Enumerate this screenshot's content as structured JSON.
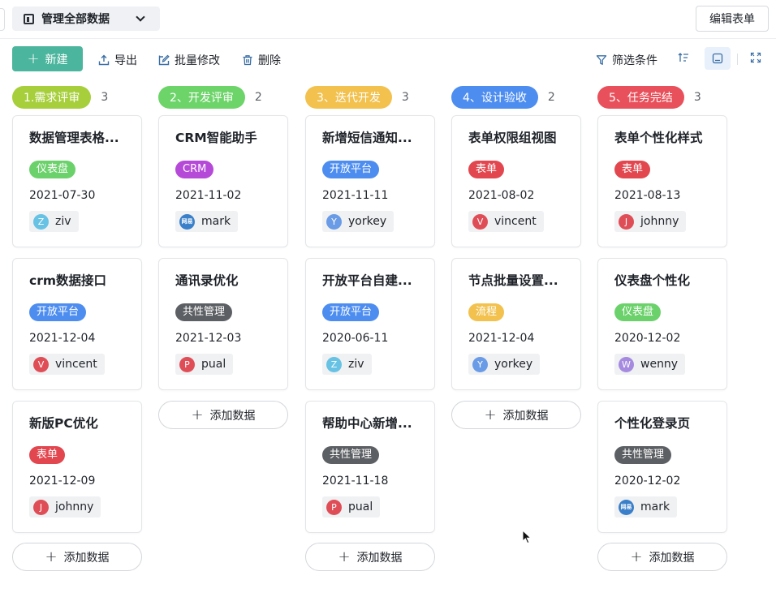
{
  "header": {
    "view_title": "管理全部数据",
    "edit_form_label": "编辑表单"
  },
  "toolbar": {
    "new_label": "新建",
    "export_label": "导出",
    "batch_edit_label": "批量修改",
    "delete_label": "删除",
    "filter_label": "筛选条件"
  },
  "add_data_label": "添加数据",
  "colors": {
    "primary": "#4cb59d",
    "stage1": "#a6cf3b",
    "stage2": "#6dd46a",
    "stage3": "#f2c14e",
    "stage4": "#4d8df0",
    "stage5": "#e8505b",
    "tag_dashboard": "#6bd16b",
    "tag_crm": "#b64ad8",
    "tag_open_platform": "#4d8df0",
    "tag_form": "#e2474f",
    "tag_common": "#5c5f63",
    "tag_flow": "#f2c14e"
  },
  "columns": [
    {
      "label": "1.需求评审",
      "count": "3",
      "cards": [
        {
          "title": "数据管理表格...",
          "tag": "仪表盘",
          "date": "2021-07-30",
          "user": "ziv",
          "avatar": "Z"
        },
        {
          "title": "crm数据接口",
          "tag": "开放平台",
          "date": "2021-12-04",
          "user": "vincent",
          "avatar": "V"
        },
        {
          "title": "新版PC优化",
          "tag": "表单",
          "date": "2021-12-09",
          "user": "johnny",
          "avatar": "J"
        }
      ]
    },
    {
      "label": "2、开发评审",
      "count": "2",
      "cards": [
        {
          "title": "CRM智能助手",
          "tag": "CRM",
          "date": "2021-11-02",
          "user": "mark",
          "avatar": "网易"
        },
        {
          "title": "通讯录优化",
          "tag": "共性管理",
          "date": "2021-12-03",
          "user": "pual",
          "avatar": "P"
        }
      ]
    },
    {
      "label": "3、迭代开发",
      "count": "3",
      "cards": [
        {
          "title": "新增短信通知...",
          "tag": "开放平台",
          "date": "2021-11-11",
          "user": "yorkey",
          "avatar": "Y"
        },
        {
          "title": "开放平台自建...",
          "tag": "开放平台",
          "date": "2020-06-11",
          "user": "ziv",
          "avatar": "Z"
        },
        {
          "title": "帮助中心新增...",
          "tag": "共性管理",
          "date": "2021-11-18",
          "user": "pual",
          "avatar": "P"
        }
      ]
    },
    {
      "label": "4、设计验收",
      "count": "2",
      "cards": [
        {
          "title": "表单权限组视图",
          "tag": "表单",
          "date": "2021-08-02",
          "user": "vincent",
          "avatar": "V"
        },
        {
          "title": "节点批量设置...",
          "tag": "流程",
          "date": "2021-12-04",
          "user": "yorkey",
          "avatar": "Y"
        }
      ]
    },
    {
      "label": "5、任务完结",
      "count": "3",
      "cards": [
        {
          "title": "表单个性化样式",
          "tag": "表单",
          "date": "2021-08-13",
          "user": "johnny",
          "avatar": "J"
        },
        {
          "title": "仪表盘个性化",
          "tag": "仪表盘",
          "date": "2020-12-02",
          "user": "wenny",
          "avatar": "W"
        },
        {
          "title": "个性化登录页",
          "tag": "共性管理",
          "date": "2020-12-02",
          "user": "mark",
          "avatar": "网易"
        }
      ]
    }
  ]
}
